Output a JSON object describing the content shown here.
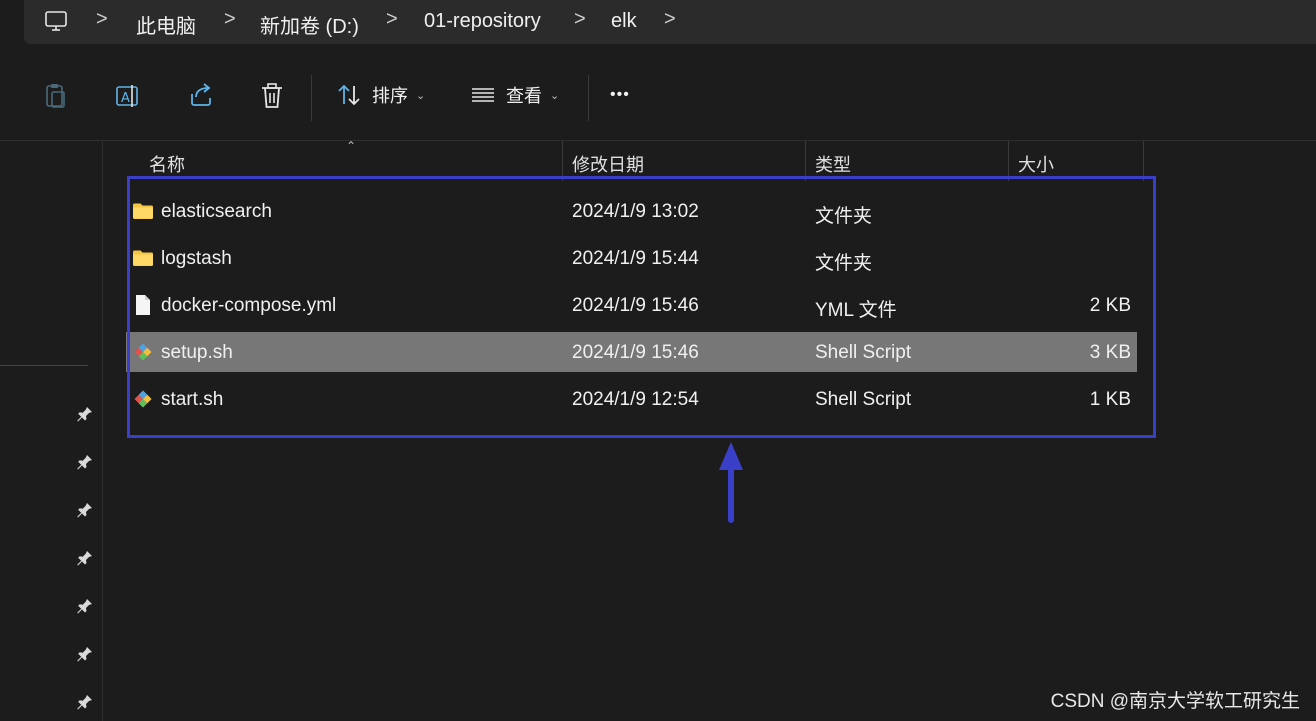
{
  "breadcrumb": {
    "items": [
      "此电脑",
      "新加卷 (D:)",
      "01-repository",
      "elk"
    ],
    "separator": ">"
  },
  "toolbar": {
    "sort_label": "排序",
    "view_label": "查看",
    "more_label": "•••"
  },
  "columns": {
    "name": "名称",
    "modified": "修改日期",
    "type": "类型",
    "size": "大小"
  },
  "files": [
    {
      "name": "elasticsearch",
      "modified": "2024/1/9 13:02",
      "type": "文件夹",
      "size": "",
      "icon": "folder-icon",
      "selected": false
    },
    {
      "name": "logstash",
      "modified": "2024/1/9 15:44",
      "type": "文件夹",
      "size": "",
      "icon": "folder-icon",
      "selected": false
    },
    {
      "name": "docker-compose.yml",
      "modified": "2024/1/9 15:46",
      "type": "YML 文件",
      "size": "2 KB",
      "icon": "file-icon",
      "selected": false
    },
    {
      "name": "setup.sh",
      "modified": "2024/1/9 15:46",
      "type": "Shell Script",
      "size": "3 KB",
      "icon": "git-script-icon",
      "selected": true
    },
    {
      "name": "start.sh",
      "modified": "2024/1/9 12:54",
      "type": "Shell Script",
      "size": "1 KB",
      "icon": "git-script-icon",
      "selected": false
    }
  ],
  "watermark": "CSDN @南京大学软工研究生",
  "colors": {
    "background": "#1c1c1c",
    "selected_row": "#777777",
    "highlight": "#3a3fc8",
    "folder": "#f4c542"
  }
}
